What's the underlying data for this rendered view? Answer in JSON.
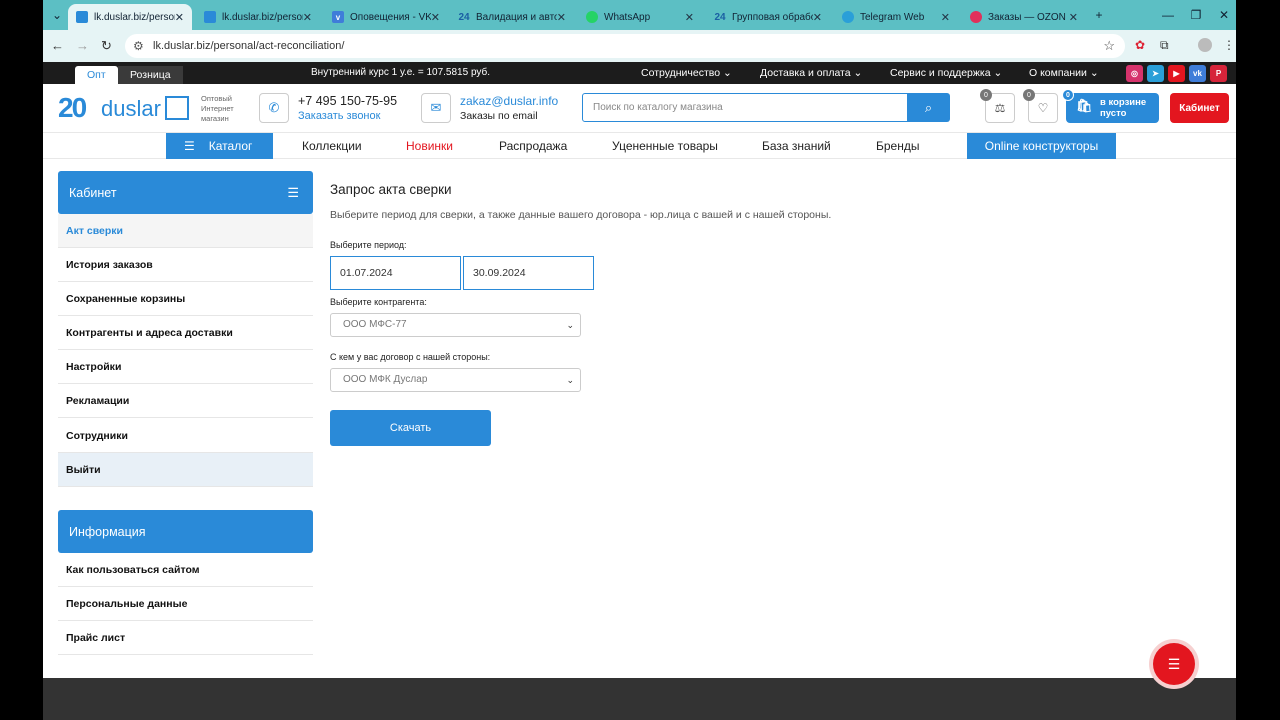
{
  "browser": {
    "tabs": [
      {
        "title": "lk.duslar.biz/person",
        "active": true,
        "icon": "duslar-favicon"
      },
      {
        "title": "lk.duslar.biz/person",
        "active": false,
        "icon": "duslar-favicon"
      },
      {
        "title": "Оповещения - VK",
        "active": false,
        "icon": "vk-icon"
      },
      {
        "title": "Валидация и автом",
        "active": false,
        "icon": "bitrix24-icon"
      },
      {
        "title": "WhatsApp",
        "active": false,
        "icon": "whatsapp-icon"
      },
      {
        "title": "Групповая обрабо",
        "active": false,
        "icon": "bitrix24-icon"
      },
      {
        "title": "Telegram Web",
        "active": false,
        "icon": "telegram-icon"
      },
      {
        "title": "Заказы — OZON",
        "active": false,
        "icon": "ozon-icon"
      }
    ],
    "url": "lk.duslar.biz/personal/act-reconciliation/"
  },
  "topstrip": {
    "opt_label": "Опт",
    "retail_label": "Розница",
    "rate": "Внутренний курс 1 у.е. = 107.5815 руб.",
    "menu": [
      "Сотрудничество",
      "Доставка и оплата",
      "Сервис и поддержка",
      "О компании"
    ]
  },
  "header": {
    "logo_num": "20",
    "logo_word": "duslar",
    "tagline": [
      "Оптовый",
      "Интернет",
      "магазин"
    ],
    "phone": "+7 495 150-75-95",
    "callback": "Заказать звонок",
    "email": "zakaz@duslar.info",
    "email_label": "Заказы по email",
    "search_placeholder": "Поиск по каталогу магазина",
    "compare_count": "0",
    "fav_count": "0",
    "cart_count": "0",
    "cart_line1": "в корзине",
    "cart_line2": "пусто",
    "cabinet": "Кабинет"
  },
  "mainnav": {
    "catalog": "Каталог",
    "items": [
      "Коллекции",
      "Новинки",
      "Распродажа",
      "Уцененные товары",
      "База знаний",
      "Бренды"
    ],
    "online": "Online конструкторы"
  },
  "sidebar": {
    "cabinet_title": "Кабинет",
    "cabinet_items": [
      "Акт сверки",
      "История заказов",
      "Сохраненные корзины",
      "Контрагенты и адреса доставки",
      "Настройки",
      "Рекламации",
      "Сотрудники",
      "Выйти"
    ],
    "info_title": "Информация",
    "info_items": [
      "Как пользоваться сайтом",
      "Персональные данные",
      "Прайс лист"
    ]
  },
  "content": {
    "title": "Запрос акта сверки",
    "lead": "Выберите период для сверки, а также данные вашего договора - юр.лица с вашей и с нашей стороны.",
    "period_label": "Выберите период:",
    "date_from": "01.07.2024",
    "date_to": "30.09.2024",
    "counterparty_label": "Выберите контрагента:",
    "counterparty_value": "ООО МФС-77",
    "our_side_label": "С кем у вас договор с нашей стороны:",
    "our_side_value": "ООО МФК Дуслар",
    "download": "Скачать"
  },
  "colors": {
    "accent": "#2a8ad8",
    "red": "#e3161f",
    "tabbar": "#5cbfc4"
  }
}
